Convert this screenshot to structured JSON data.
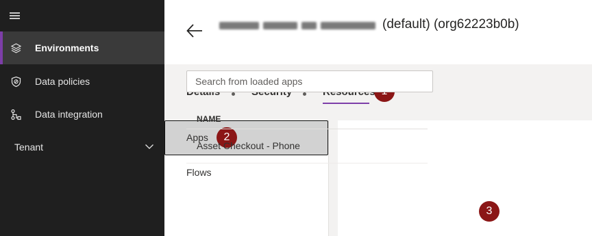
{
  "sidebar": {
    "items": [
      {
        "label": "Environments",
        "icon": "layers-icon",
        "active": true
      },
      {
        "label": "Data policies",
        "icon": "shield-icon"
      },
      {
        "label": "Data integration",
        "icon": "flow-icon"
      },
      {
        "label": "Tenant",
        "icon": "chevron-down-icon"
      }
    ]
  },
  "header": {
    "title_suffix": "(default) (org62223b0b)"
  },
  "tabs": [
    {
      "label": "Details"
    },
    {
      "label": "Security"
    },
    {
      "label": "Resources",
      "selected": true
    }
  ],
  "subnav": [
    {
      "label": "Apps",
      "selected": true
    },
    {
      "label": "Flows"
    }
  ],
  "search": {
    "placeholder": "Search from loaded apps"
  },
  "table": {
    "columns": [
      "NAME"
    ],
    "rows": [
      {
        "name": "Asset Checkout - Phone"
      }
    ]
  },
  "badges": [
    "1",
    "2",
    "3"
  ],
  "colors": {
    "accent": "#7d3ea8",
    "badge": "#8b1616",
    "sidebar_bg": "#1f1f1f",
    "sidebar_active": "#3a3a3a",
    "content_bg": "#f3f2f1"
  }
}
